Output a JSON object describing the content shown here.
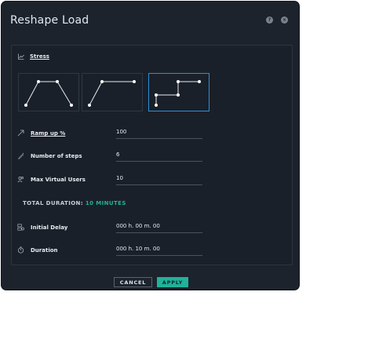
{
  "dialog": {
    "title": "Reshape Load",
    "help_label": "?",
    "close_label": "×"
  },
  "stress_section": {
    "title": "Stress",
    "profiles": [
      "ramp-up-hold-ramp-down-icon",
      "ramp-up-hold-icon",
      "step-up-icon"
    ],
    "selected_profile_index": 2
  },
  "fields": {
    "ramp_up": {
      "label": "Ramp up %",
      "value": "100"
    },
    "steps": {
      "label": "Number of steps",
      "value": "6"
    },
    "max_users": {
      "label": "Max Virtual Users",
      "value": "10"
    },
    "initial_delay": {
      "label": "Initial Delay",
      "value": "000 h. 00 m. 00"
    },
    "duration": {
      "label": "Duration",
      "value": "000 h. 10 m. 00"
    }
  },
  "total_duration": {
    "label": "TOTAL DURATION:",
    "value": "10 MINUTES"
  },
  "buttons": {
    "cancel": "CANCEL",
    "apply": "APPLY"
  },
  "colors": {
    "accent": "#1fb39a",
    "selected_border": "#2f8fd4",
    "background": "#1c232c"
  }
}
